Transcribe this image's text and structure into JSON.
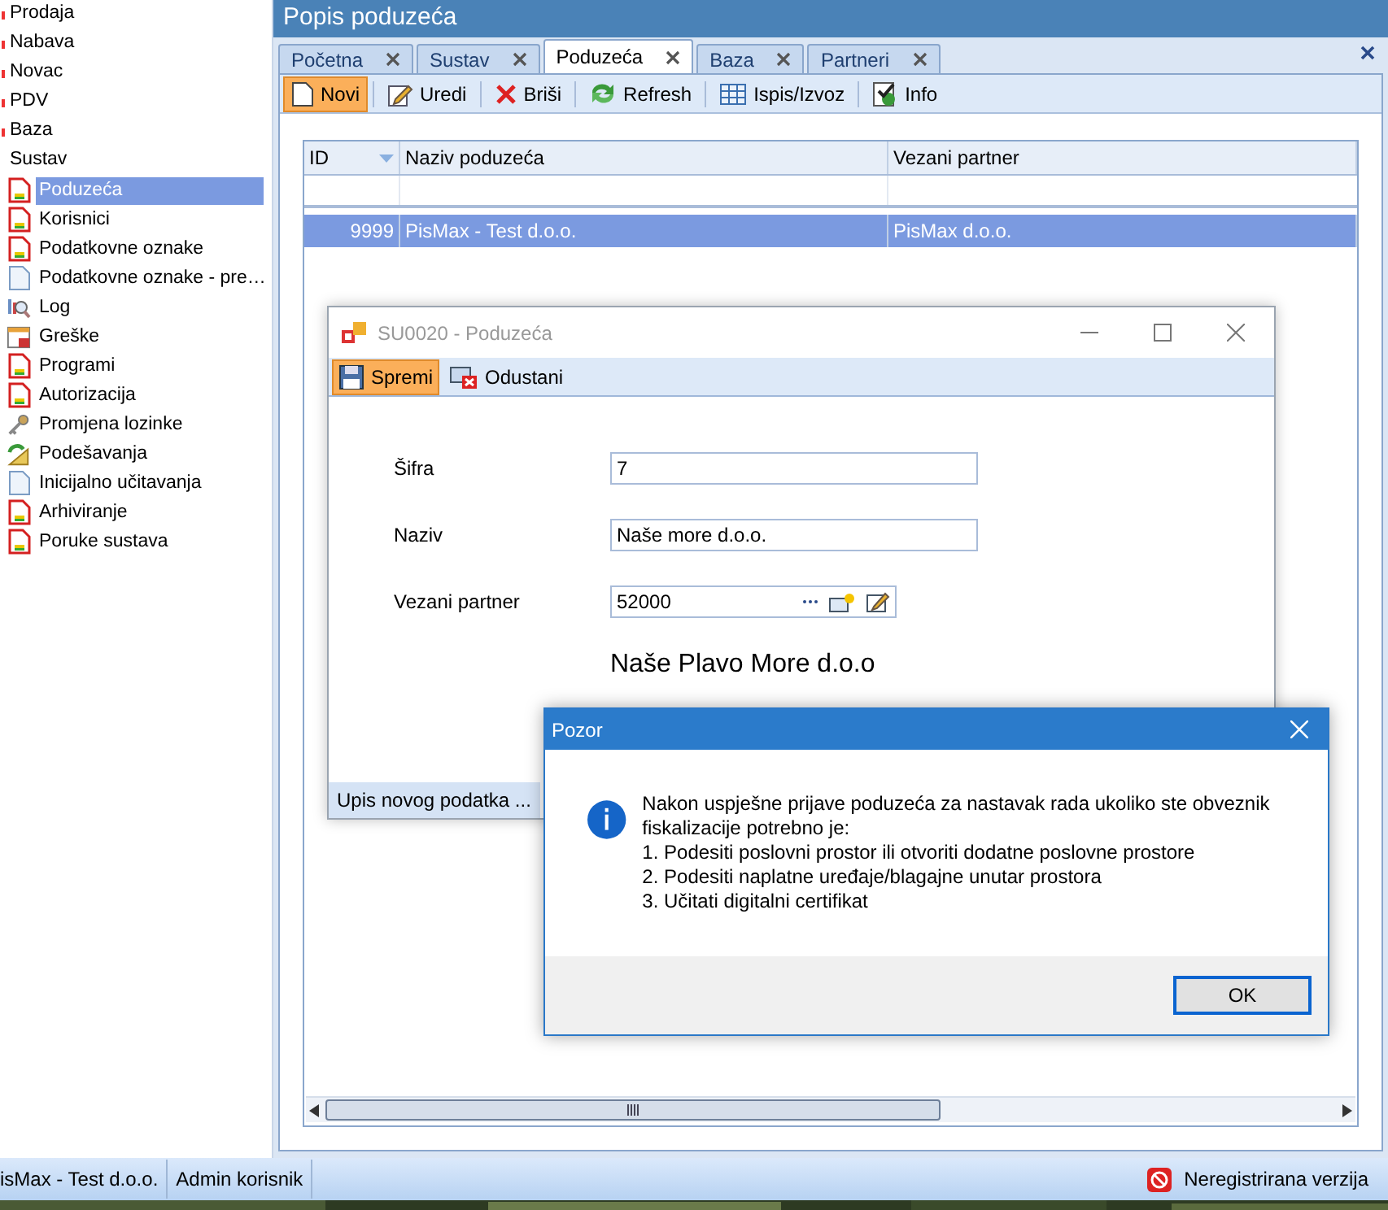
{
  "sidebar": {
    "items": [
      {
        "label": "Prodaja"
      },
      {
        "label": "Nabava"
      },
      {
        "label": "Novac"
      },
      {
        "label": "PDV"
      },
      {
        "label": "Baza"
      },
      {
        "label": "Sustav",
        "children": [
          {
            "label": "Poduzeća",
            "kind": "doc_red",
            "selected": true
          },
          {
            "label": "Korisnici",
            "kind": "doc_red",
            "selected": false
          },
          {
            "label": "Podatkovne oznake",
            "kind": "doc_red",
            "selected": false
          },
          {
            "label": "Podatkovne oznake - pre…",
            "kind": "doc_blank",
            "selected": false
          },
          {
            "label": "Log",
            "kind": "log",
            "selected": false
          },
          {
            "label": "Greške",
            "kind": "sheet",
            "selected": false
          },
          {
            "label": "Programi",
            "kind": "doc_red",
            "selected": false
          },
          {
            "label": "Autorizacija",
            "kind": "doc_red",
            "selected": false
          },
          {
            "label": "Promjena lozinke",
            "kind": "keys",
            "selected": false
          },
          {
            "label": "Podešavanja",
            "kind": "settings",
            "selected": false
          },
          {
            "label": "Inicijalno učitavanja",
            "kind": "doc_blank",
            "selected": false
          },
          {
            "label": "Arhiviranje",
            "kind": "doc_red",
            "selected": false
          },
          {
            "label": "Poruke sustava",
            "kind": "doc_red",
            "selected": false
          }
        ]
      }
    ]
  },
  "main": {
    "title": "Popis poduzeća",
    "tabs": [
      {
        "label": "Početna",
        "selected": false
      },
      {
        "label": "Sustav",
        "selected": false
      },
      {
        "label": "Poduzeća",
        "selected": true
      },
      {
        "label": "Baza",
        "selected": false
      },
      {
        "label": "Partneri",
        "selected": false
      }
    ],
    "toolbar": [
      {
        "label": "Novi",
        "kind": "new",
        "selected": true
      },
      {
        "label": "Uredi",
        "kind": "edit",
        "selected": false
      },
      {
        "label": "Briši",
        "kind": "delete",
        "selected": false
      },
      {
        "label": "Refresh",
        "kind": "refresh",
        "selected": false
      },
      {
        "label": "Ispis/Izvoz",
        "kind": "table",
        "selected": false
      },
      {
        "label": "Info",
        "kind": "info",
        "selected": false
      }
    ],
    "grid": {
      "columns": [
        "ID",
        "Naziv poduzeća",
        "Vezani partner"
      ],
      "rows": [
        {
          "cells": [
            "9999",
            "PisMax - Test d.o.o.",
            "PisMax d.o.o."
          ],
          "selected": true
        }
      ]
    }
  },
  "form_window": {
    "title": "SU0020 - Poduzeća",
    "toolbar": [
      {
        "label": "Spremi",
        "kind": "save",
        "selected": true
      },
      {
        "label": "Odustani",
        "kind": "cancel",
        "selected": false
      }
    ],
    "fields": [
      {
        "label": "Šifra",
        "value": "7",
        "kind": "text"
      },
      {
        "label": "Naziv",
        "value": "Naše more d.o.o.",
        "kind": "text"
      },
      {
        "label": "Vezani partner",
        "value": "52000",
        "kind": "lookup"
      }
    ],
    "partner_name": "Naše Plavo More d.o.o",
    "status": "Upis novog podatka ..."
  },
  "message_box": {
    "title": "Pozor",
    "lines": [
      "Nakon uspješne prijave poduzeća za nastavak rada ukoliko ste obveznik fiskalizacije potrebno je:",
      "1. Podesiti poslovni prostor ili otvoriti dodatne poslovne prostore",
      "2. Podesiti naplatne uređaje/blagajne unutar prostora",
      "3. Učitati digitalni certifikat"
    ],
    "button": "OK"
  },
  "status_bar": [
    {
      "label": "isMax - Test d.o.o."
    },
    {
      "label": "Admin korisnik"
    },
    {
      "label": "Neregistrirana verzija"
    }
  ]
}
